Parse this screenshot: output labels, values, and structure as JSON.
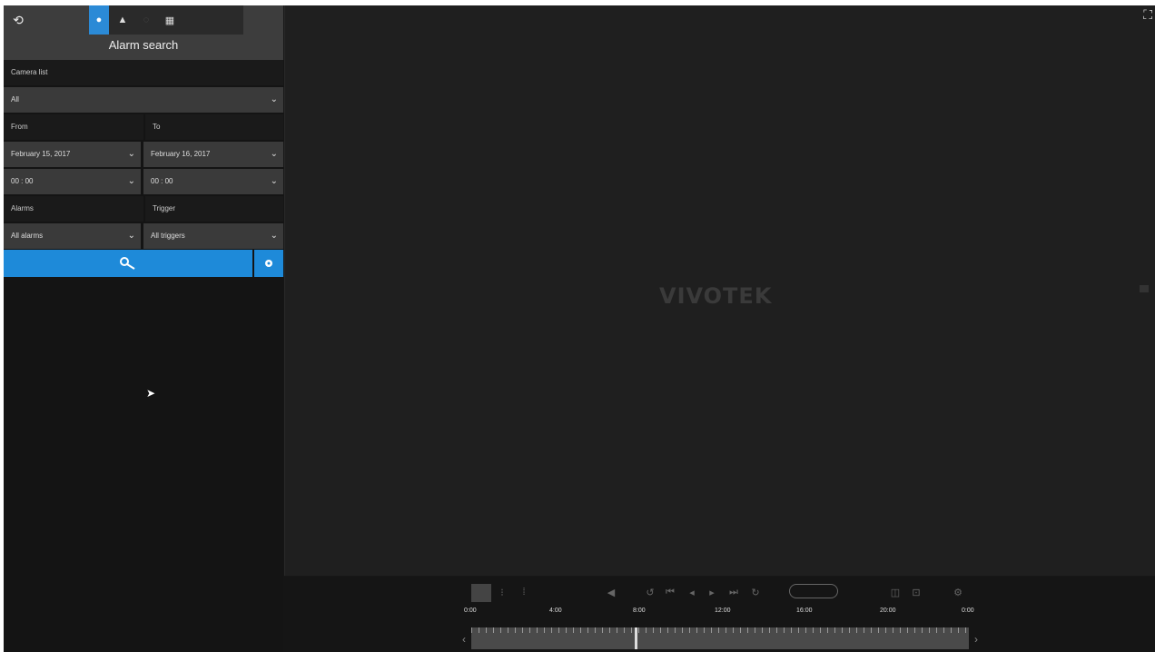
{
  "header": {
    "title": "Alarm search"
  },
  "tabs": [
    {
      "name": "playback",
      "icon": "●"
    },
    {
      "name": "alarm",
      "icon": "▲"
    },
    {
      "name": "event",
      "icon": "◌"
    },
    {
      "name": "grid",
      "icon": "▦"
    }
  ],
  "camera_list": {
    "label": "Camera list",
    "value": "All"
  },
  "from": {
    "label": "From",
    "date": "February 15, 2017",
    "time": "00 : 00"
  },
  "to": {
    "label": "To",
    "date": "February 16, 2017",
    "time": "00 : 00"
  },
  "alarms": {
    "label": "Alarms",
    "value": "All alarms"
  },
  "trigger": {
    "label": "Trigger",
    "value": "All triggers"
  },
  "video": {
    "logo": "VIVOTEK"
  },
  "timeline": {
    "ticks": [
      "0:00",
      "4:00",
      "8:00",
      "12:00",
      "16:00",
      "20:00",
      "0:00"
    ]
  },
  "colors": {
    "accent": "#1e8ad9",
    "bg": "#161616"
  }
}
